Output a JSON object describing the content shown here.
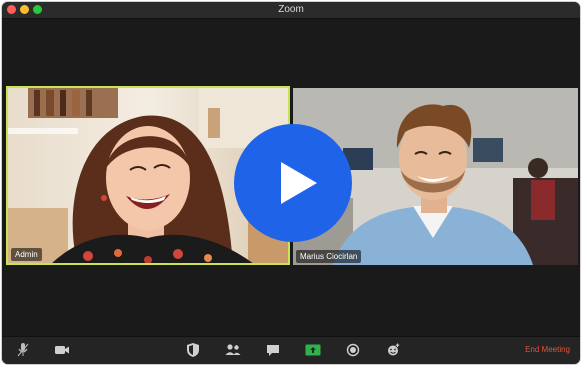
{
  "window": {
    "title": "Zoom"
  },
  "participants": [
    {
      "name": "Admin",
      "active_speaker": true
    },
    {
      "name": "Marius Ciocirlan",
      "active_speaker": false
    }
  ],
  "toolbar": {
    "end_meeting_label": "End Meeting",
    "icons": [
      "microphone-icon",
      "video-camera-icon",
      "security-shield-icon",
      "participants-icon",
      "chat-icon",
      "share-screen-icon",
      "record-icon",
      "reactions-icon"
    ]
  },
  "overlay": {
    "icon": "play-icon"
  },
  "colors": {
    "active_border": "#c9e356",
    "play_button": "#1f63e8",
    "share_green": "#2fb24c",
    "end_meeting": "#e0533c"
  }
}
